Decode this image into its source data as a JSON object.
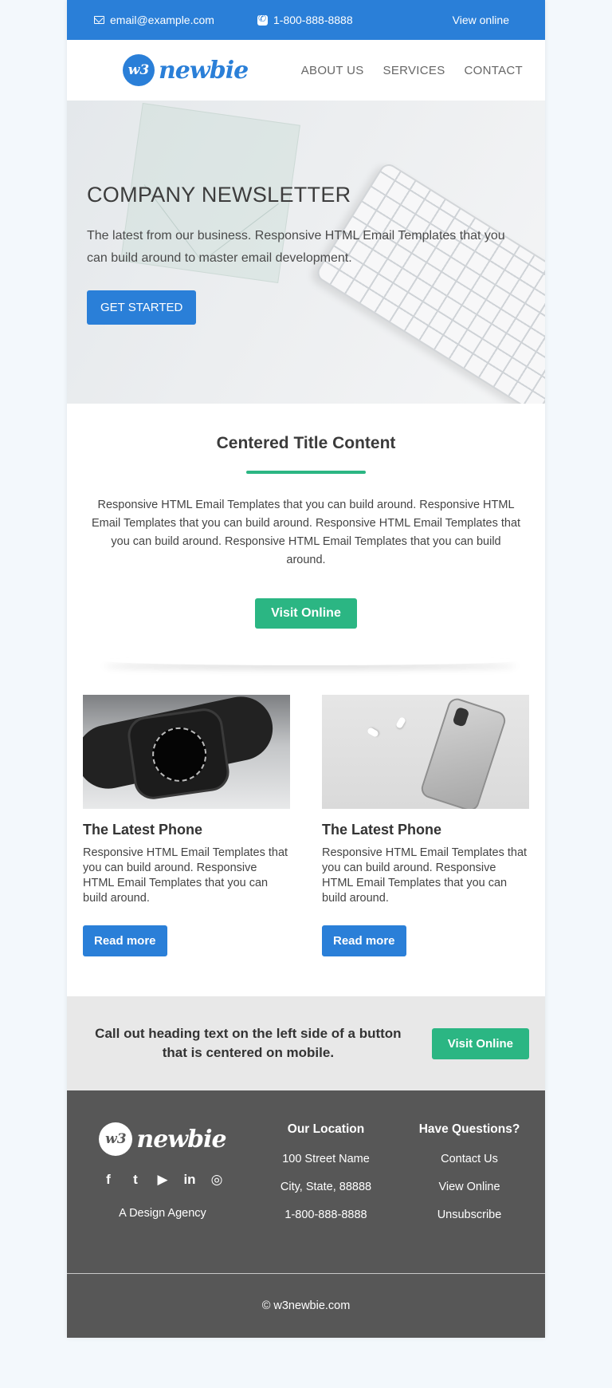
{
  "topbar": {
    "email": "email@example.com",
    "phone": "1-800-888-8888",
    "view_online": "View online"
  },
  "header": {
    "logo_badge": "w3",
    "logo_text": "newbie",
    "nav": [
      "ABOUT US",
      "SERVICES",
      "CONTACT"
    ]
  },
  "hero": {
    "title": "COMPANY NEWSLETTER",
    "text": "The latest from our business. Responsive HTML Email Templates that you can build around to master email development.",
    "button": "GET STARTED"
  },
  "centered": {
    "title": "Centered Title Content",
    "text": "Responsive HTML Email Templates that you can build around. Responsive HTML Email Templates that you can build around. Responsive HTML Email Templates that you can build around. Responsive HTML Email Templates that you can build around.",
    "button": "Visit Online"
  },
  "cards": [
    {
      "title": "The Latest Phone",
      "text": "Responsive HTML Email Templates that you can build around. Responsive HTML Email Templates that you can build around.",
      "button": "Read more"
    },
    {
      "title": "The Latest Phone",
      "text": "Responsive HTML Email Templates that you can build around. Responsive HTML Email Templates that you can build around.",
      "button": "Read more"
    }
  ],
  "callout": {
    "heading": "Call out heading text on the left side of a button that is centered on mobile.",
    "button": "Visit Online"
  },
  "footer": {
    "logo_badge": "w3",
    "logo_text": "newbie",
    "socials": [
      "f",
      "t",
      "▶",
      "in",
      "◎"
    ],
    "tagline": "A Design Agency",
    "location_title": "Our Location",
    "location": [
      "100 Street Name",
      "City, State, 88888",
      "1-800-888-8888"
    ],
    "questions_title": "Have Questions?",
    "questions": [
      "Contact Us",
      "View Online",
      "Unsubscribe"
    ],
    "copyright": "© w3newbie.com"
  },
  "colors": {
    "brand_blue": "#2a7fd8",
    "accent_green": "#2bb683",
    "footer_gray": "#575757"
  }
}
